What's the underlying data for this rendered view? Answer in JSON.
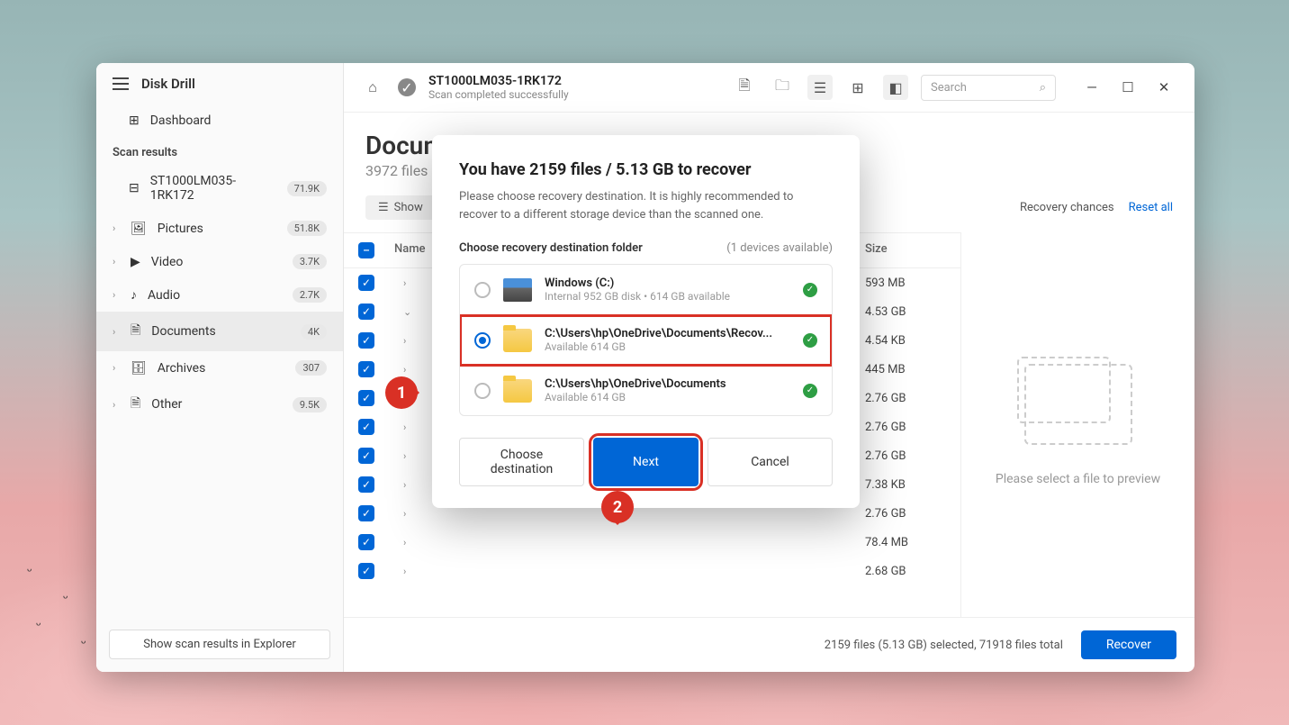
{
  "app": {
    "name": "Disk Drill"
  },
  "sidebar": {
    "dashboard": "Dashboard",
    "scan_results_label": "Scan results",
    "drive_item": {
      "label": "ST1000LM035-1RK172",
      "count": "71.9K"
    },
    "categories": [
      {
        "label": "Pictures",
        "count": "51.8K"
      },
      {
        "label": "Video",
        "count": "3.7K"
      },
      {
        "label": "Audio",
        "count": "2.7K"
      },
      {
        "label": "Documents",
        "count": "4K",
        "active": true
      },
      {
        "label": "Archives",
        "count": "307"
      },
      {
        "label": "Other",
        "count": "9.5K"
      }
    ],
    "footer_button": "Show scan results in Explorer"
  },
  "topbar": {
    "title": "ST1000LM035-1RK172",
    "subtitle": "Scan completed successfully",
    "search_placeholder": "Search"
  },
  "content": {
    "heading": "Documents",
    "subheading": "3972 files",
    "show_button": "Show",
    "recovery_chances": "Recovery chances",
    "reset": "Reset all"
  },
  "table": {
    "col_name": "Name",
    "col_size": "Size",
    "rows": [
      {
        "size": "593 MB"
      },
      {
        "size": "4.53 GB"
      },
      {
        "size": "4.54 KB"
      },
      {
        "size": "445 MB"
      },
      {
        "size": "2.76 GB"
      },
      {
        "size": "2.76 GB"
      },
      {
        "size": "2.76 GB"
      },
      {
        "size": "7.38 KB"
      },
      {
        "size": "2.76 GB"
      },
      {
        "size": "78.4 MB"
      },
      {
        "size": "2.68 GB"
      }
    ]
  },
  "preview": {
    "text": "Please select a file to preview"
  },
  "bottom": {
    "status": "2159 files (5.13 GB) selected, 71918 files total",
    "recover_button": "Recover"
  },
  "modal": {
    "title": "You have 2159 files / 5.13 GB to recover",
    "description": "Please choose recovery destination. It is highly recommended to recover to a different storage device than the scanned one.",
    "dest_label": "Choose recovery destination folder",
    "devices_available": "(1 devices available)",
    "destinations": [
      {
        "name": "Windows (C:)",
        "detail": "Internal 952 GB disk • 614 GB available",
        "type": "drive",
        "selected": false
      },
      {
        "name": "C:\\Users\\hp\\OneDrive\\Documents\\Recov...",
        "detail": "Available 614 GB",
        "type": "folder",
        "selected": true,
        "highlighted": true
      },
      {
        "name": "C:\\Users\\hp\\OneDrive\\Documents",
        "detail": "Available 614 GB",
        "type": "folder",
        "selected": false
      }
    ],
    "choose_button": "Choose destination",
    "next_button": "Next",
    "cancel_button": "Cancel"
  },
  "annotations": {
    "one": "1",
    "two": "2"
  }
}
